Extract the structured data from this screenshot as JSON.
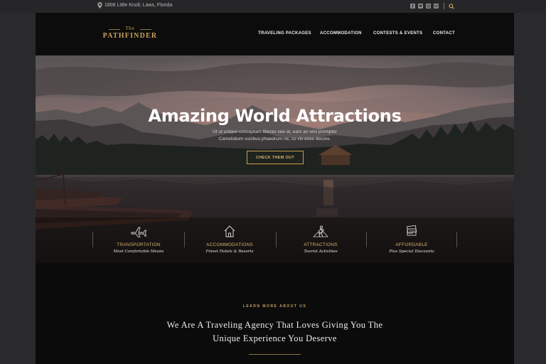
{
  "topbar": {
    "address": "1808 Little Knoll, Laws, Florida",
    "social_icons": [
      "facebook-icon",
      "twitter-icon",
      "instagram-icon",
      "email-icon"
    ],
    "search_icon": "search-icon"
  },
  "brand": {
    "the": "The",
    "name": "PATHFINDER"
  },
  "nav": {
    "items": [
      "TRAVELING PACKAGES",
      "ACCOMMODATION",
      "CONTESTS & EVENTS",
      "CONTACT"
    ]
  },
  "hero": {
    "title": "Amazing World Attractions",
    "subtitle_line1": "Ut ut unique conceptam liberav see at, eam an wisi prompter",
    "subtitle_line2": "Camelsbum vocibus phaedrum ne, cu vix esse decore.",
    "button": "CHECK THEM OUT"
  },
  "features": [
    {
      "title": "TRANSPORTATION",
      "subtitle": "Most Comfortable Means",
      "icon": "airplane-icon"
    },
    {
      "title": "ACCOMMODATIONS",
      "subtitle": "Finest Hotels & Resorts",
      "icon": "house-icon"
    },
    {
      "title": "ATTRACTIONS",
      "subtitle": "Tourist Activities",
      "icon": "hiker-icon"
    },
    {
      "title": "AFFORDABLE",
      "subtitle": "Plus Special Discounts",
      "icon": "discount-coupon-icon"
    }
  ],
  "about": {
    "kicker": "LEARN MORE ABOUT US",
    "heading_line1": "We Are A Traveling Agency That Loves Giving You The",
    "heading_line2": "Unique Experience You Deserve"
  },
  "colors": {
    "accent": "#c8a25a",
    "background": "#0b0b0c",
    "outer": "#2a2a2c"
  }
}
